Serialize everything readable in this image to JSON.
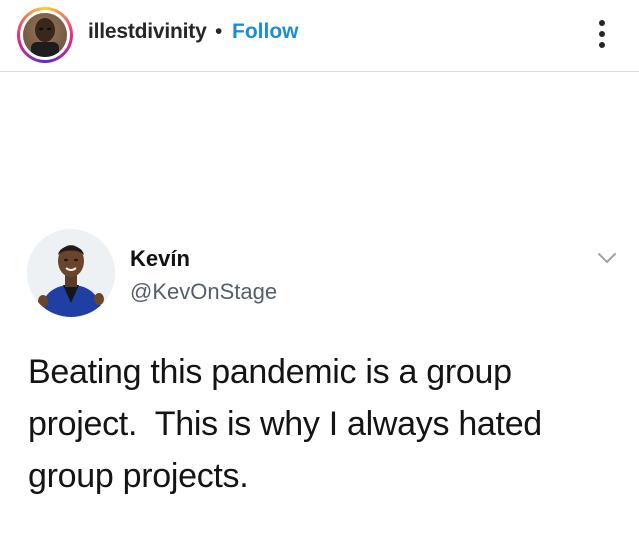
{
  "header": {
    "username": "illestdivinity",
    "separator": "•",
    "follow_label": "Follow",
    "follow_color": "#1a8ed8",
    "more_icon": "more-vertical-icon"
  },
  "tweet": {
    "author_name": "Kevín",
    "author_handle": "@KevOnStage",
    "menu_icon": "chevron-down-icon",
    "text_lines": [
      "Beating this pandemic is a group",
      "project.  This is why I always hated",
      "group projects."
    ]
  },
  "colors": {
    "text": "#141414",
    "handle": "#555f6a",
    "divider": "#dbdbdb"
  }
}
